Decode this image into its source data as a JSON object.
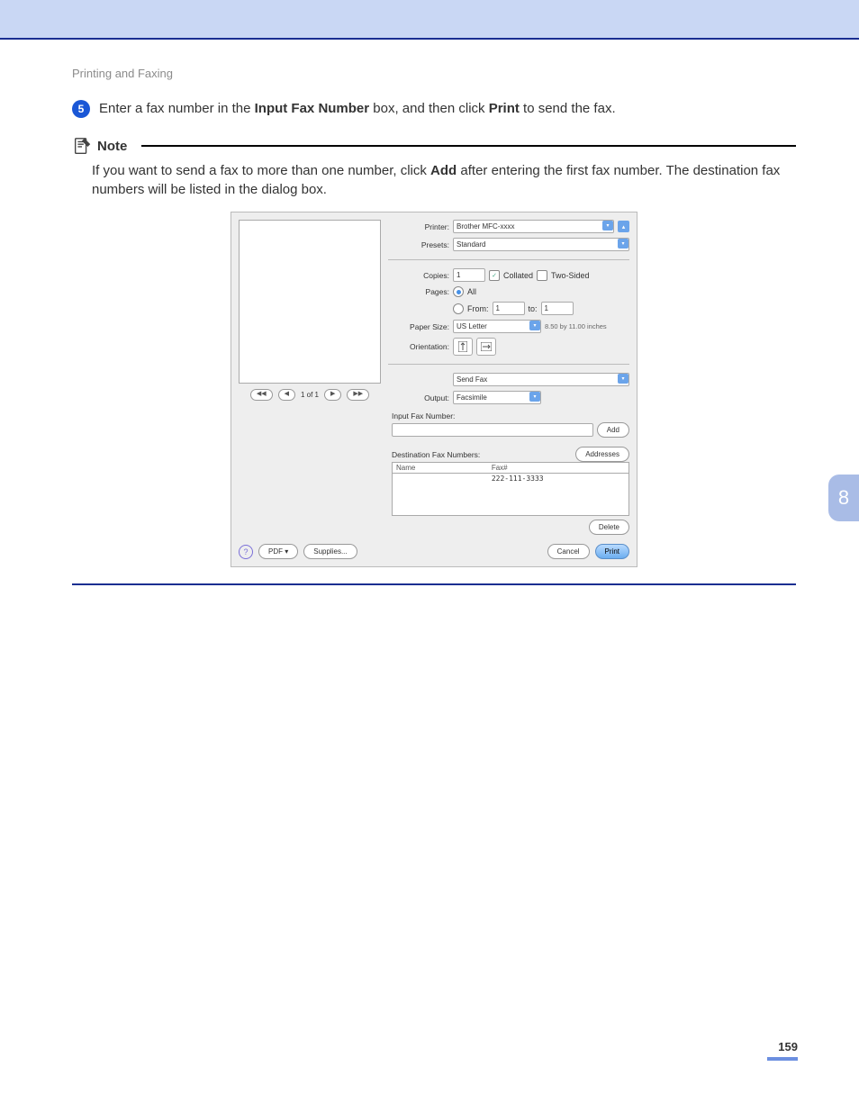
{
  "header": {
    "section": "Printing and Faxing"
  },
  "step": {
    "number": "5",
    "text_before_bold1": "Enter a fax number in the ",
    "bold1": "Input Fax Number",
    "text_mid": " box, and then click ",
    "bold2": "Print",
    "text_after": " to send the fax."
  },
  "note": {
    "label": "Note",
    "body_before_bold": "If you want to send a fax to more than one number, click ",
    "body_bold": "Add",
    "body_after": " after entering the first fax number. The destination fax numbers will be listed in the dialog box."
  },
  "dialog": {
    "printer_label": "Printer:",
    "printer_value": "Brother MFC-xxxx",
    "presets_label": "Presets:",
    "presets_value": "Standard",
    "copies_label": "Copies:",
    "copies_value": "1",
    "collated": "Collated",
    "two_sided": "Two-Sided",
    "pages_label": "Pages:",
    "pages_all": "All",
    "pages_from": "From:",
    "from_value": "1",
    "to": "to:",
    "to_value": "1",
    "papersize_label": "Paper Size:",
    "papersize_value": "US Letter",
    "papersize_dim": "8.50 by 11.00 inches",
    "orientation_label": "Orientation:",
    "section_value": "Send Fax",
    "output_label": "Output:",
    "output_value": "Facsimile",
    "input_fax_label": "Input Fax Number:",
    "add": "Add",
    "dest_label": "Destination Fax Numbers:",
    "addresses": "Addresses",
    "col_name": "Name",
    "col_fax": "Fax#",
    "sample_fax": "222-111-3333",
    "delete": "Delete",
    "pdf": "PDF ▾",
    "supplies": "Supplies...",
    "cancel": "Cancel",
    "print": "Print",
    "nav_of": "1 of 1",
    "nav_first": "◀◀",
    "nav_prev": "◀",
    "nav_next": "▶",
    "nav_last": "▶▶"
  },
  "side": {
    "chapter": "8"
  },
  "footer": {
    "page": "159"
  }
}
